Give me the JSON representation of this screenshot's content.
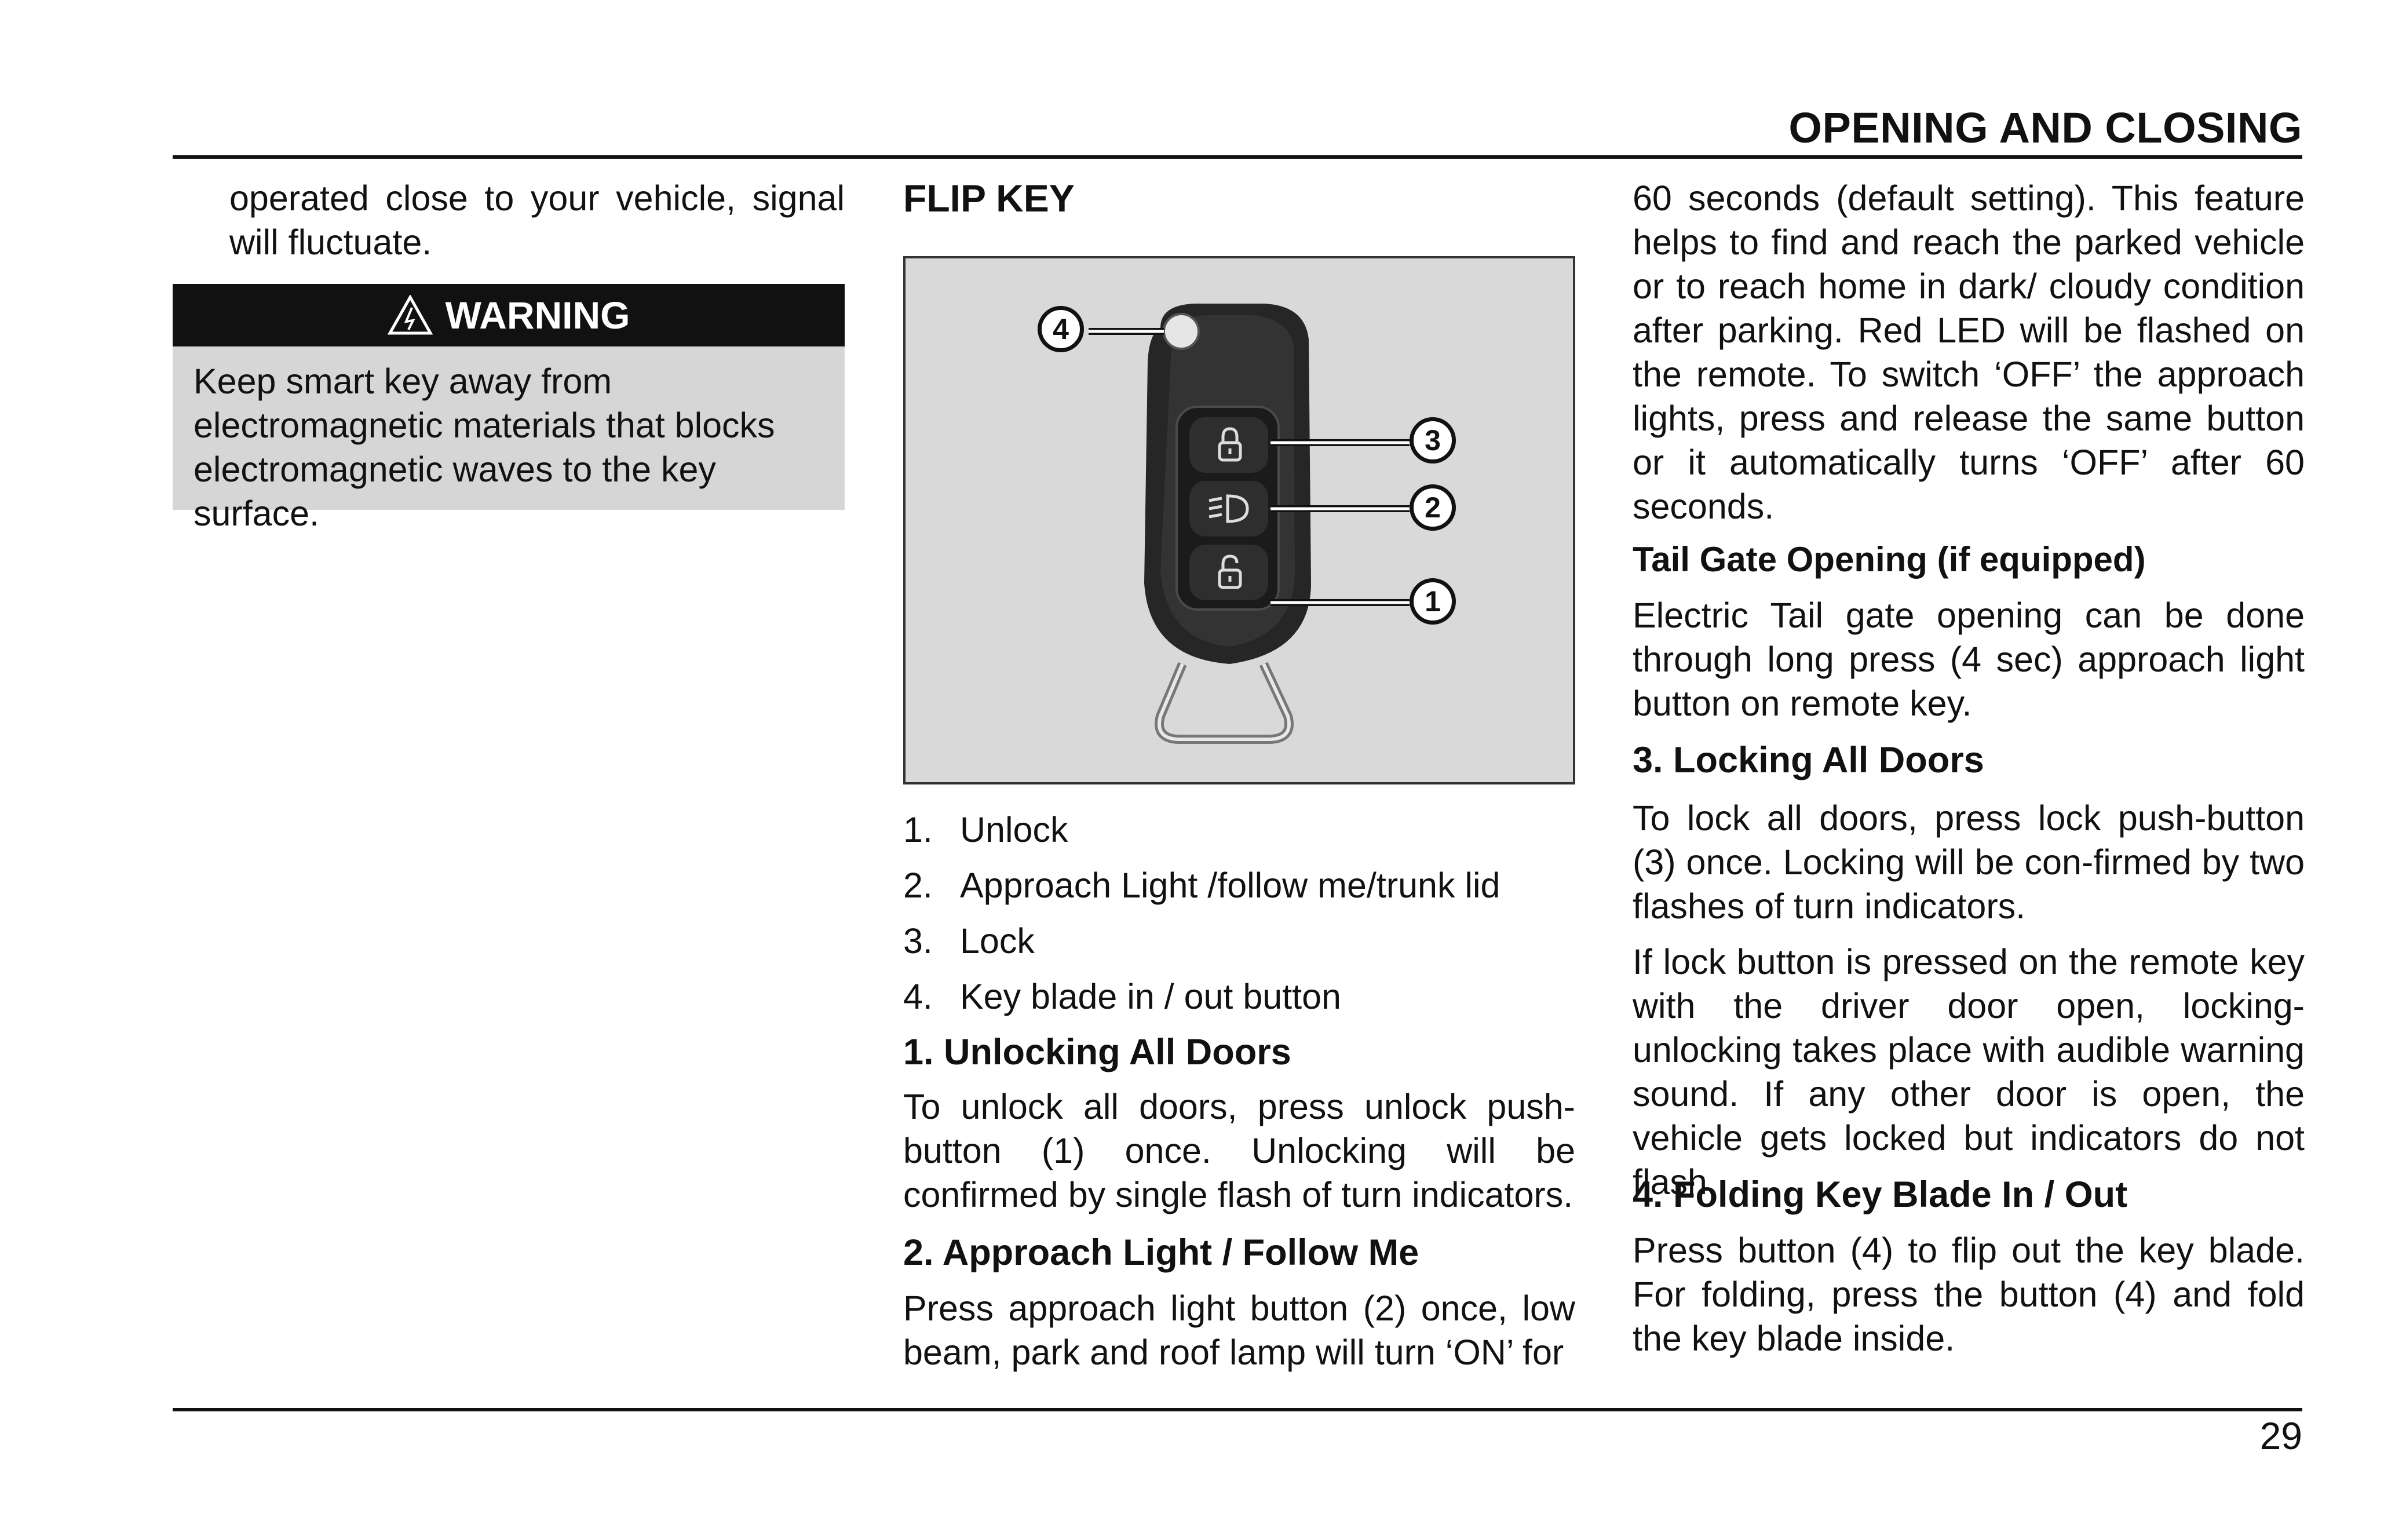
{
  "header": {
    "section_title": "OPENING AND CLOSING"
  },
  "col1": {
    "intro": "operated close to your vehicle, signal will fluctuate.",
    "warning_title": "WARNING",
    "warning_text": "Keep smart key away from electromagnetic materials that blocks electromagnetic waves to the key surface."
  },
  "col2": {
    "title": "FLIP KEY",
    "figure_icons": [
      "lock-icon",
      "approach-light-icon",
      "unlock-icon"
    ],
    "callouts": [
      "4",
      "3",
      "2",
      "1"
    ],
    "legend": [
      {
        "num": "1.",
        "text": "Unlock"
      },
      {
        "num": "2.",
        "text": "Approach Light /follow me/trunk lid"
      },
      {
        "num": "3.",
        "text": "Lock"
      },
      {
        "num": "4.",
        "text": "Key blade in / out button"
      }
    ],
    "unlock_heading": "1. Unlocking All Doors",
    "unlock_text": "To unlock all doors, press unlock push-button (1) once. Unlocking will be confirmed by single flash of turn indicators.",
    "approach_heading": "2. Approach Light / Follow Me",
    "approach_text": "Press approach light button (2) once, low beam, park and roof lamp will turn ‘ON’ for"
  },
  "col3": {
    "approach_cont": "60 seconds (default setting). This feature helps to find and reach the parked vehicle or to reach home in dark/ cloudy condition after parking. Red LED will be flashed on the remote. To switch ‘OFF’ the approach lights, press and release the same button or it automatically turns ‘OFF’ after 60 seconds.",
    "tailgate_heading": "Tail Gate Opening (if equipped)",
    "tailgate_text": "Electric Tail gate opening can be done through long press (4 sec) approach light button on remote key.",
    "lock_heading": "3. Locking All Doors",
    "lock_text": "To lock all doors, press lock push-button (3) once. Locking will be con-firmed by two flashes of turn indicators.",
    "lock_note": "If lock button is pressed on the remote key with the driver door open, locking-unlocking takes place with audible warning sound. If any other door is open, the vehicle gets locked but indicators do not flash.",
    "fold_heading": "4. Folding Key Blade In / Out",
    "fold_text": "Press button (4) to flip out the key blade. For folding, press the button (4) and fold the key blade inside."
  },
  "footer": {
    "page_number": "29"
  }
}
